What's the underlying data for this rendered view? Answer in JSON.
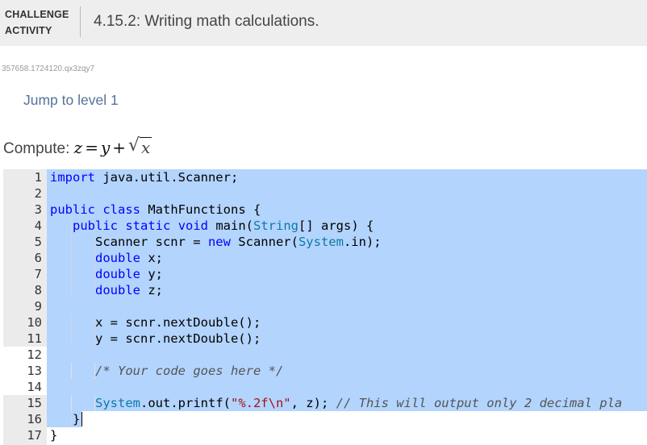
{
  "header": {
    "label_line1": "CHALLENGE",
    "label_line2": "ACTIVITY",
    "title": "4.15.2: Writing math calculations."
  },
  "activity_id": "357658.1724120.qx3zqy7",
  "jump_link": "Jump to level 1",
  "compute": {
    "label": "Compute:",
    "var_z": "z",
    "eq": "=",
    "var_y": "y",
    "plus": "+",
    "sqrt_symbol": "√",
    "var_x": "x"
  },
  "editor": {
    "line_numbers": [
      "1",
      "2",
      "3",
      "4",
      "5",
      "6",
      "7",
      "8",
      "9",
      "10",
      "11",
      "12",
      "13",
      "14",
      "15",
      "16",
      "17"
    ],
    "lines": [
      "import java.util.Scanner;",
      "",
      "public class MathFunctions {",
      "   public static void main(String[] args) {",
      "      Scanner scnr = new Scanner(System.in);",
      "      double x;",
      "      double y;",
      "      double z;",
      "",
      "      x = scnr.nextDouble();",
      "      y = scnr.nextDouble();",
      "",
      "      /* Your code goes here */",
      "",
      "      System.out.printf(\"%.2f\\n\", z); // This will output only 2 decimal pla",
      "   }",
      "}"
    ]
  },
  "colors": {
    "keyword": "#0000ff",
    "type_ref": "#0b7aa8",
    "string": "#a31515",
    "comment": "#555555",
    "selection": "#b3d4fd",
    "link": "#56729a"
  }
}
